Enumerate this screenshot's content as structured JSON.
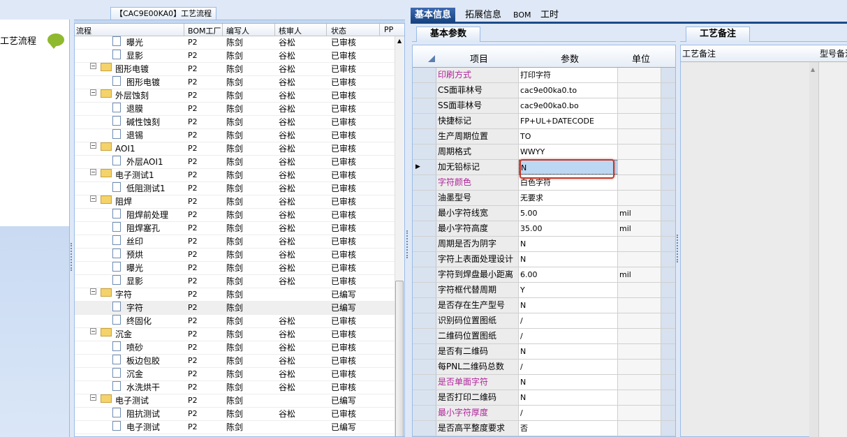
{
  "top_title": "【CAC9E00KA0】工艺流程",
  "left_sidebar": {
    "label": "工艺流程"
  },
  "tree_grid": {
    "columns": [
      "流程",
      "BOM工厂",
      "编写人",
      "核审人",
      "状态",
      "PP"
    ],
    "rows": [
      {
        "name": "曝光",
        "type": "doc",
        "bom": "P2",
        "writer": "陈剑",
        "reviewer": "谷松",
        "status": "已审核"
      },
      {
        "name": "显影",
        "type": "doc",
        "bom": "P2",
        "writer": "陈剑",
        "reviewer": "谷松",
        "status": "已审核"
      },
      {
        "name": "图形电镀",
        "type": "folder",
        "bom": "P2",
        "writer": "陈剑",
        "reviewer": "谷松",
        "status": "已审核"
      },
      {
        "name": "图形电镀",
        "type": "doc",
        "bom": "P2",
        "writer": "陈剑",
        "reviewer": "谷松",
        "status": "已审核"
      },
      {
        "name": "外层蚀刻",
        "type": "folder",
        "bom": "P2",
        "writer": "陈剑",
        "reviewer": "谷松",
        "status": "已审核"
      },
      {
        "name": "退膜",
        "type": "doc",
        "bom": "P2",
        "writer": "陈剑",
        "reviewer": "谷松",
        "status": "已审核"
      },
      {
        "name": "碱性蚀刻",
        "type": "doc",
        "bom": "P2",
        "writer": "陈剑",
        "reviewer": "谷松",
        "status": "已审核"
      },
      {
        "name": "退锡",
        "type": "doc",
        "bom": "P2",
        "writer": "陈剑",
        "reviewer": "谷松",
        "status": "已审核"
      },
      {
        "name": "AOI1",
        "type": "folder",
        "bom": "P2",
        "writer": "陈剑",
        "reviewer": "谷松",
        "status": "已审核"
      },
      {
        "name": "外层AOI1",
        "type": "doc",
        "bom": "P2",
        "writer": "陈剑",
        "reviewer": "谷松",
        "status": "已审核"
      },
      {
        "name": "电子测试1",
        "type": "folder",
        "bom": "P2",
        "writer": "陈剑",
        "reviewer": "谷松",
        "status": "已审核"
      },
      {
        "name": "低阻测试1",
        "type": "doc",
        "bom": "P2",
        "writer": "陈剑",
        "reviewer": "谷松",
        "status": "已审核"
      },
      {
        "name": "阻焊",
        "type": "folder",
        "bom": "P2",
        "writer": "陈剑",
        "reviewer": "谷松",
        "status": "已审核"
      },
      {
        "name": "阻焊前处理",
        "type": "doc",
        "bom": "P2",
        "writer": "陈剑",
        "reviewer": "谷松",
        "status": "已审核"
      },
      {
        "name": "阻焊塞孔",
        "type": "doc",
        "bom": "P2",
        "writer": "陈剑",
        "reviewer": "谷松",
        "status": "已审核"
      },
      {
        "name": "丝印",
        "type": "doc",
        "bom": "P2",
        "writer": "陈剑",
        "reviewer": "谷松",
        "status": "已审核"
      },
      {
        "name": "预烘",
        "type": "doc",
        "bom": "P2",
        "writer": "陈剑",
        "reviewer": "谷松",
        "status": "已审核"
      },
      {
        "name": "曝光",
        "type": "doc",
        "bom": "P2",
        "writer": "陈剑",
        "reviewer": "谷松",
        "status": "已审核"
      },
      {
        "name": "显影",
        "type": "doc",
        "bom": "P2",
        "writer": "陈剑",
        "reviewer": "谷松",
        "status": "已审核"
      },
      {
        "name": "字符",
        "type": "folder",
        "bom": "P2",
        "writer": "陈剑",
        "reviewer": "",
        "status": "已编写"
      },
      {
        "name": "字符",
        "type": "doc",
        "bom": "P2",
        "writer": "陈剑",
        "reviewer": "",
        "status": "已编写",
        "selected": true
      },
      {
        "name": "终固化",
        "type": "doc",
        "bom": "P2",
        "writer": "陈剑",
        "reviewer": "谷松",
        "status": "已审核"
      },
      {
        "name": "沉金",
        "type": "folder",
        "bom": "P2",
        "writer": "陈剑",
        "reviewer": "谷松",
        "status": "已审核"
      },
      {
        "name": "喷砂",
        "type": "doc",
        "bom": "P2",
        "writer": "陈剑",
        "reviewer": "谷松",
        "status": "已审核"
      },
      {
        "name": "板边包胶",
        "type": "doc",
        "bom": "P2",
        "writer": "陈剑",
        "reviewer": "谷松",
        "status": "已审核"
      },
      {
        "name": "沉金",
        "type": "doc",
        "bom": "P2",
        "writer": "陈剑",
        "reviewer": "谷松",
        "status": "已审核"
      },
      {
        "name": "水洗烘干",
        "type": "doc",
        "bom": "P2",
        "writer": "陈剑",
        "reviewer": "谷松",
        "status": "已审核"
      },
      {
        "name": "电子测试",
        "type": "folder",
        "bom": "P2",
        "writer": "陈剑",
        "reviewer": "",
        "status": "已编写"
      },
      {
        "name": "阻抗测试",
        "type": "doc",
        "bom": "P2",
        "writer": "陈剑",
        "reviewer": "谷松",
        "status": "已审核"
      },
      {
        "name": "电子测试",
        "type": "doc",
        "bom": "P2",
        "writer": "陈剑",
        "reviewer": "",
        "status": "已编写"
      }
    ]
  },
  "tabs": [
    "基本信息",
    "拓展信息",
    "BOM",
    "工时"
  ],
  "basic_params": {
    "title": "基本参数",
    "columns": [
      "项目",
      "参数",
      "单位"
    ],
    "rows": [
      {
        "item": "印刷方式",
        "value": "打印字符",
        "unit": "",
        "highlight": true
      },
      {
        "item": "CS面菲林号",
        "value": "cac9e00ka0.to",
        "unit": ""
      },
      {
        "item": "SS面菲林号",
        "value": "cac9e00ka0.bo",
        "unit": ""
      },
      {
        "item": "快捷标记",
        "value": "FP+UL+DATECODE",
        "unit": ""
      },
      {
        "item": "生产周期位置",
        "value": "TO",
        "unit": ""
      },
      {
        "item": "周期格式",
        "value": "WWYY",
        "unit": ""
      },
      {
        "item": "加无铅标记",
        "value": "N",
        "unit": "",
        "current": true
      },
      {
        "item": "字符颜色",
        "value": "白色字符",
        "unit": "",
        "highlight": true
      },
      {
        "item": "油墨型号",
        "value": "无要求",
        "unit": ""
      },
      {
        "item": "最小字符线宽",
        "value": "5.00",
        "unit": "mil"
      },
      {
        "item": "最小字符高度",
        "value": "35.00",
        "unit": "mil"
      },
      {
        "item": "周期是否为阴字",
        "value": "N",
        "unit": ""
      },
      {
        "item": "字符上表面处理设计",
        "value": "N",
        "unit": ""
      },
      {
        "item": "字符到焊盘最小距离",
        "value": "6.00",
        "unit": "mil"
      },
      {
        "item": "字符框代替周期",
        "value": "Y",
        "unit": ""
      },
      {
        "item": "是否存在生产型号",
        "value": "N",
        "unit": ""
      },
      {
        "item": "识别码位置图纸",
        "value": "/",
        "unit": ""
      },
      {
        "item": "二维码位置图纸",
        "value": "/",
        "unit": ""
      },
      {
        "item": "是否有二维码",
        "value": "N",
        "unit": ""
      },
      {
        "item": "每PNL二维码总数",
        "value": "/",
        "unit": ""
      },
      {
        "item": "是否单面字符",
        "value": "N",
        "unit": "",
        "highlight": true
      },
      {
        "item": "是否打印二维码",
        "value": "N",
        "unit": ""
      },
      {
        "item": "最小字符厚度",
        "value": "/",
        "unit": "",
        "highlight": true
      },
      {
        "item": "是否高平整度要求",
        "value": "否",
        "unit": ""
      }
    ]
  },
  "process_notes": {
    "title": "工艺备注",
    "columns": [
      "工艺备注",
      "型号备注"
    ]
  },
  "colors": {
    "highlight_text": "#b0229a",
    "active_tab": "#15417f",
    "callout": "#c0392b"
  }
}
